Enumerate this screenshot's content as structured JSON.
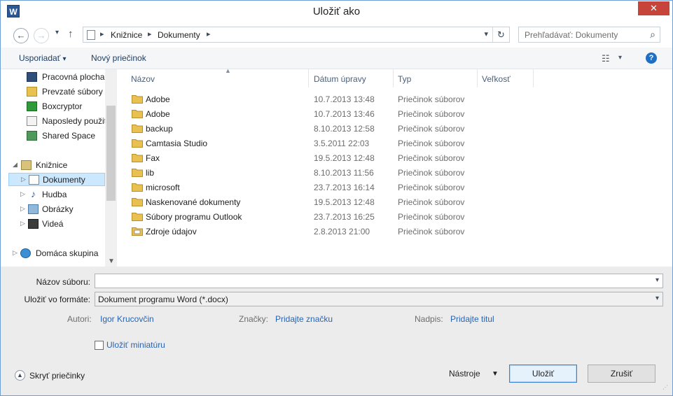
{
  "window": {
    "title": "Uložiť ako",
    "app_icon_letter": "W",
    "close_glyph": "✕"
  },
  "navbar": {
    "back_glyph": "←",
    "forward_glyph": "→",
    "recent_glyph": "▾",
    "up_glyph": "↑",
    "breadcrumb": [
      "Knižnice",
      "Dokumenty"
    ],
    "refresh_glyph": "↻",
    "search_placeholder": "Prehľadávať: Dokumenty"
  },
  "commands": {
    "organize": "Usporiadať",
    "new_folder": "Nový priečinok"
  },
  "nav_pane": {
    "items": [
      {
        "label": "Pracovná plocha",
        "icon": "desktop-icon"
      },
      {
        "label": "Prevzaté súbory",
        "icon": "downloads-icon"
      },
      {
        "label": "Boxcryptor",
        "icon": "boxcryptor-icon"
      },
      {
        "label": "Naposledy použité miesta",
        "icon": "recent-places-icon"
      },
      {
        "label": "Shared Space",
        "icon": "shared-space-icon"
      },
      {
        "label": "Knižnice",
        "icon": "libraries-icon"
      },
      {
        "label": "Dokumenty",
        "icon": "documents-icon"
      },
      {
        "label": "Hudba",
        "icon": "music-icon"
      },
      {
        "label": "Obrázky",
        "icon": "pictures-icon"
      },
      {
        "label": "Videá",
        "icon": "videos-icon"
      },
      {
        "label": "Domáca skupina",
        "icon": "homegroup-icon"
      }
    ]
  },
  "file_list": {
    "columns": [
      "Názov",
      "Dátum úpravy",
      "Typ",
      "Veľkosť"
    ],
    "rows": [
      {
        "name": "Adobe",
        "date": "10.7.2013 13:48",
        "type": "Priečinok súborov"
      },
      {
        "name": "Adobe",
        "date": "10.7.2013 13:46",
        "type": "Priečinok súborov"
      },
      {
        "name": "backup",
        "date": "8.10.2013 12:58",
        "type": "Priečinok súborov"
      },
      {
        "name": "Camtasia Studio",
        "date": "3.5.2011 22:03",
        "type": "Priečinok súborov"
      },
      {
        "name": "Fax",
        "date": "19.5.2013 12:48",
        "type": "Priečinok súborov"
      },
      {
        "name": "lib",
        "date": "8.10.2013 11:56",
        "type": "Priečinok súborov"
      },
      {
        "name": "microsoft",
        "date": "23.7.2013 16:14",
        "type": "Priečinok súborov"
      },
      {
        "name": "Naskenované dokumenty",
        "date": "19.5.2013 12:48",
        "type": "Priečinok súborov"
      },
      {
        "name": "Súbory programu Outlook",
        "date": "23.7.2013 16:25",
        "type": "Priečinok súborov"
      },
      {
        "name": "Zdroje údajov",
        "date": "2.8.2013 21:00",
        "type": "Priečinok súborov"
      }
    ]
  },
  "form": {
    "filename_label": "Názov súboru:",
    "filename_value": "",
    "format_label": "Uložiť vo formáte:",
    "format_value": "Dokument programu Word (*.docx)",
    "authors_label": "Autori:",
    "authors_value": "Igor Krucovčin",
    "tags_label": "Značky:",
    "tags_value": "Pridajte značku",
    "title_label": "Nadpis:",
    "title_value": "Pridajte titul",
    "thumbnail_label": "Uložiť miniatúru"
  },
  "footer": {
    "hide_folders": "Skryť priečinky",
    "tools": "Nástroje",
    "save": "Uložiť",
    "cancel": "Zrušiť"
  },
  "colors": {
    "accent": "#2b5797",
    "close": "#c7443a",
    "link": "#2a64b0",
    "folder": "#e8c150",
    "selection": "#cce8ff"
  }
}
